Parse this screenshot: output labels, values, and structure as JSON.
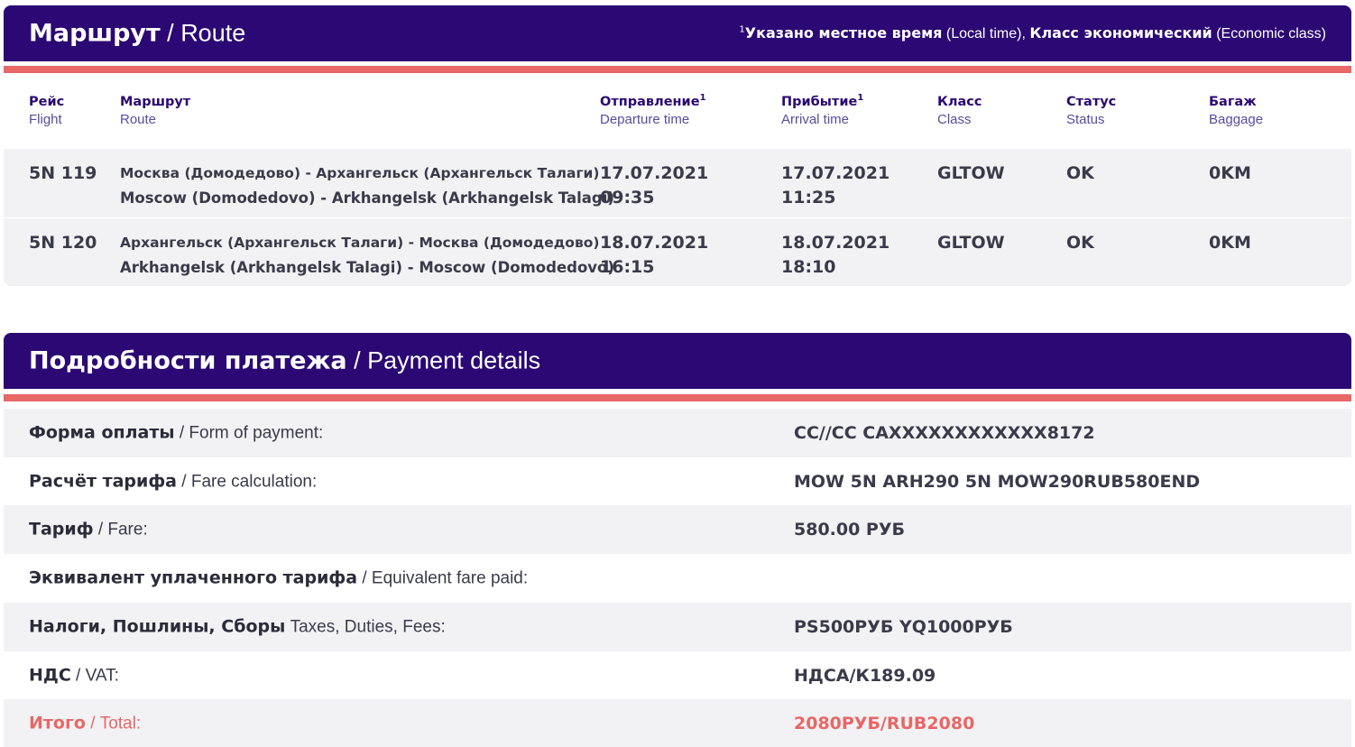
{
  "route_section": {
    "title_ru": "Маршрут",
    "title_sep": " / ",
    "title_en": "Route",
    "note_marker": "1",
    "note_local_ru": "Указано местное время",
    "note_local_en": " (Local time), ",
    "note_class_ru": "Класс экономический",
    "note_class_en": " (Economic class)",
    "columns": {
      "flight": {
        "ru": "Рейс",
        "en": "Flight"
      },
      "route": {
        "ru": "Маршрут",
        "en": "Route"
      },
      "departure": {
        "ru": "Отправление",
        "en": "Departure time",
        "marker": "1"
      },
      "arrival": {
        "ru": "Прибытие",
        "en": "Arrival time",
        "marker": "1"
      },
      "class": {
        "ru": "Класс",
        "en": "Class"
      },
      "status": {
        "ru": "Статус",
        "en": "Status"
      },
      "baggage": {
        "ru": "Багаж",
        "en": "Baggage"
      }
    },
    "rows": [
      {
        "flight": "5N 119",
        "route_ru": "Москва (Домодедово) - Архангельск (Архангельск Талаги)",
        "route_en": "Moscow (Domodedovo) - Arkhangelsk (Arkhangelsk Talagi)",
        "dep_date": "17.07.2021",
        "dep_time": "09:35",
        "arr_date": "17.07.2021",
        "arr_time": "11:25",
        "class": "GLTOW",
        "status": "OK",
        "baggage": "0KM"
      },
      {
        "flight": "5N 120",
        "route_ru": "Архангельск (Архангельск Талаги) - Москва (Домодедово)",
        "route_en": "Arkhangelsk (Arkhangelsk Talagi) - Moscow (Domodedovo)",
        "dep_date": "18.07.2021",
        "dep_time": "16:15",
        "arr_date": "18.07.2021",
        "arr_time": "18:10",
        "class": "GLTOW",
        "status": "OK",
        "baggage": "0KM"
      }
    ]
  },
  "payment_section": {
    "title_ru": "Подробности платежа",
    "title_sep": " / ",
    "title_en": "Payment details",
    "rows": [
      {
        "label_ru": "Форма оплаты",
        "label_en": " / Form of payment:",
        "value": "CC//CC CAXXXXXXXXXXXX8172"
      },
      {
        "label_ru": "Расчёт тарифа",
        "label_en": " / Fare calculation:",
        "value": "MOW 5N ARH290 5N MOW290RUB580END"
      },
      {
        "label_ru": "Тариф",
        "label_en": " / Fare:",
        "value": "580.00 РУБ"
      },
      {
        "label_ru": "Эквивалент уплаченного тарифа",
        "label_en": " / Equivalent fare paid:",
        "value": ""
      },
      {
        "label_ru": "Налоги, Пошлины, Сборы",
        "label_en": " Taxes, Duties, Fees:",
        "value": "PS500РУБ YQ1000РУБ"
      },
      {
        "label_ru": "НДС",
        "label_en": " / VAT:",
        "value": "НДСА/К189.09"
      },
      {
        "label_ru": "Итого",
        "label_en": " / Total:",
        "value": "2080РУБ/RUB2080"
      }
    ]
  },
  "colors": {
    "header_bg": "#2b0873",
    "accent_red": "#e86767",
    "row_alt": "#f2f2f4"
  }
}
